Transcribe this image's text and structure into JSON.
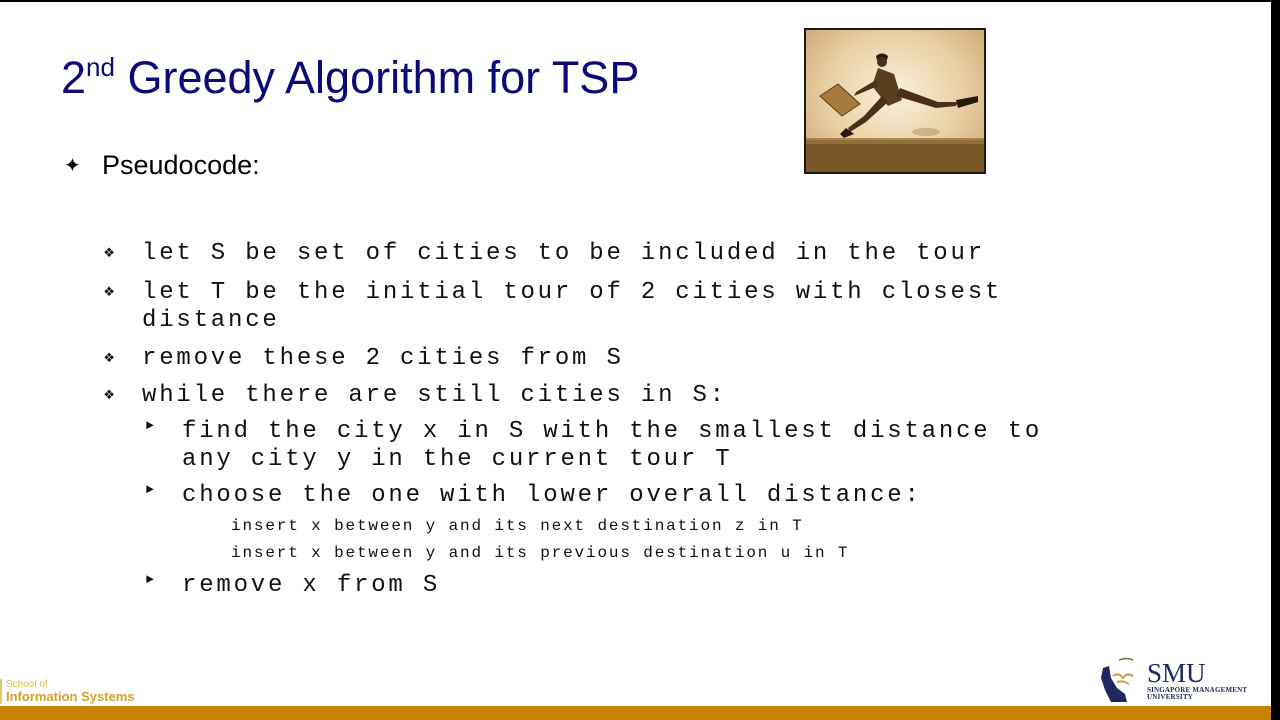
{
  "slide": {
    "title_prefix": "2",
    "title_sup": "nd",
    "title_rest": " Greedy Algorithm for TSP",
    "image": "traveling-salesman-jumping-with-briefcase",
    "heading_bullet": "✦",
    "heading": "Pseudocode:",
    "items": [
      {
        "bullet": "❖",
        "lines": [
          "let S be set of cities to be included in the tour"
        ]
      },
      {
        "bullet": "❖",
        "lines": [
          "let T be the initial tour of 2 cities with closest",
          "distance"
        ]
      },
      {
        "bullet": "❖",
        "lines": [
          "remove these 2 cities from S"
        ]
      },
      {
        "bullet": "❖",
        "lines": [
          "while there are still cities in S:"
        ]
      }
    ],
    "subitems": [
      {
        "bullet": "►",
        "lines": [
          "find the city x in S with the smallest distance to",
          "any city y in the current tour T"
        ]
      },
      {
        "bullet": "►",
        "lines": [
          "choose the one with lower overall distance:"
        ]
      },
      {
        "bullet": "►",
        "lines": [
          "remove x from S"
        ]
      }
    ],
    "options": [
      "insert x between y and its next destination z in T",
      "insert x between y and its previous destination u in T"
    ]
  },
  "footer": {
    "school_line1": "School of",
    "school_line2": "Information Systems",
    "smu_word": "SMU",
    "smu_sub1": "SINGAPORE MANAGEMENT",
    "smu_sub2": "UNIVERSITY",
    "bar_color": "#c98100",
    "title_color": "#0a0a78"
  }
}
